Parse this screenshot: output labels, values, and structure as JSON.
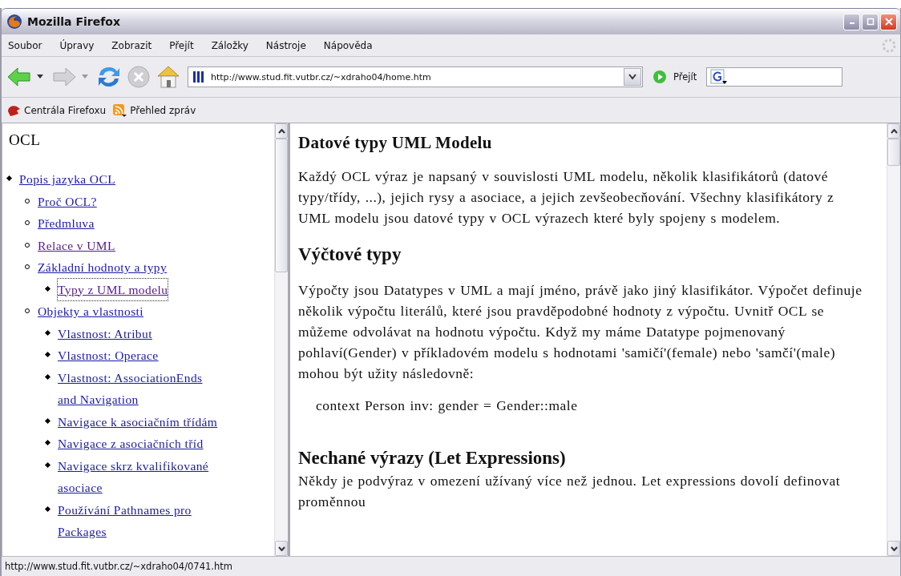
{
  "window": {
    "title": "Mozilla Firefox"
  },
  "menu": [
    {
      "label": "Soubor"
    },
    {
      "label": "Úpravy"
    },
    {
      "label": "Zobrazit"
    },
    {
      "label": "Přejít"
    },
    {
      "label": "Záložky"
    },
    {
      "label": "Nástroje"
    },
    {
      "label": "Nápověda"
    }
  ],
  "navigation": {
    "url": "http://www.stud.fit.vutbr.cz/~xdraho04/home.htm",
    "go_label": "Přejít"
  },
  "bookmarks": [
    {
      "label": "Centrála Firefoxu",
      "kind": "site"
    },
    {
      "label": "Přehled zpráv",
      "kind": "feed"
    }
  ],
  "sidebar": {
    "title": "OCL",
    "items": [
      {
        "label": "Popis jazyka OCL",
        "visited": false,
        "selected": false,
        "children": [
          {
            "label": "Proč OCL?",
            "visited": false,
            "selected": false
          },
          {
            "label": "Předmluva",
            "visited": false,
            "selected": false
          },
          {
            "label": "Relace v UML",
            "visited": true,
            "selected": false
          },
          {
            "label": "Základní hodnoty a typy",
            "visited": false,
            "selected": false,
            "children": [
              {
                "label": "Typy z UML modelu",
                "visited": true,
                "selected": true
              }
            ]
          },
          {
            "label": "Objekty a vlastnosti",
            "visited": false,
            "selected": false,
            "children": [
              {
                "label": "Vlastnost: Atribut",
                "visited": false,
                "selected": false
              },
              {
                "label": "Vlastnost: Operace",
                "visited": false,
                "selected": false
              },
              {
                "label": "Vlastnost: AssociationEnds and Navigation",
                "visited": false,
                "selected": false
              },
              {
                "label": "Navigace k asociačním třídám",
                "visited": false,
                "selected": false
              },
              {
                "label": "Navigace z asociačních tříd",
                "visited": false,
                "selected": false
              },
              {
                "label": "Navigace skrz kvalifikované asociace",
                "visited": false,
                "selected": false
              },
              {
                "label": "Používání Pathnames pro Packages",
                "visited": false,
                "selected": false
              }
            ]
          }
        ]
      }
    ]
  },
  "article": [
    {
      "kind": "subheading",
      "text": "Datové typy UML Modelu"
    },
    {
      "kind": "paragraph",
      "text": "Každý OCL výraz je napsaný v souvislosti UML modelu, několik klasifikátorů (datové typy/třídy, ...), jejich rysy a asociace, a jejich zevšeobecňování. Všechny klasifikátory z UML modelu jsou datové typy v OCL výrazech které byly spojeny s modelem."
    },
    {
      "kind": "heading",
      "text": "Výčtové typy"
    },
    {
      "kind": "paragraph",
      "text": "Výpočty jsou Datatypes v UML a mají jméno, právě jako jiný klasifikátor. Výpočet definuje několik výpočtu literálů, které jsou pravděpodobné hodnoty z výpočtu. Uvnitř OCL se můžeme odvolávat na hodnotu výpočtu. Když my máme Datatype pojmenovaný pohlaví(Gender) v příkladovém modelu s hodnotami 'samičí'(female) nebo 'samčí'(male) mohou být užity následovně:"
    },
    {
      "kind": "code",
      "text": "context Person inv: gender = Gender::male"
    },
    {
      "kind": "heading-tight",
      "text": "Nechané výrazy (Let Expressions)"
    },
    {
      "kind": "paragraph-tight",
      "text": "Někdy je podvýraz v omezení užívaný více než jednou. Let expressions dovolí definovat proměnnou"
    }
  ],
  "status_bar": {
    "text": "http://www.stud.fit.vutbr.cz/~xdraho04/0741.htm"
  }
}
